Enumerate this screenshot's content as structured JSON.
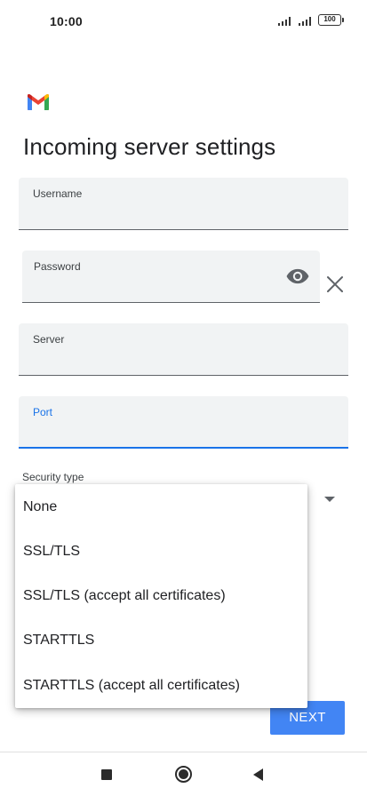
{
  "status_bar": {
    "time": "10:00",
    "battery": "100",
    "icons": [
      "signal-icon",
      "signal-icon",
      "battery-icon"
    ]
  },
  "app": {
    "logo_icon": "gmail-logo-icon",
    "title": "Incoming server settings"
  },
  "form": {
    "username": {
      "label": "Username",
      "value": ""
    },
    "password": {
      "label": "Password",
      "value": "",
      "icons": [
        "visibility-eye-icon",
        "clear-x-icon"
      ]
    },
    "server": {
      "label": "Server",
      "value": ""
    },
    "port": {
      "label": "Port",
      "value": "",
      "focused": true,
      "accent_color": "#1a73e8"
    },
    "security_type": {
      "label": "Security type",
      "expanded": true,
      "options": [
        "None",
        "SSL/TLS",
        "SSL/TLS (accept all certificates)",
        "STARTTLS",
        "STARTTLS (accept all certificates)"
      ]
    }
  },
  "actions": {
    "next_label": "NEXT",
    "next_color": "#4285f4"
  },
  "nav_bar": {
    "icons": [
      "recents-square-icon",
      "home-circle-icon",
      "back-triangle-icon"
    ]
  }
}
